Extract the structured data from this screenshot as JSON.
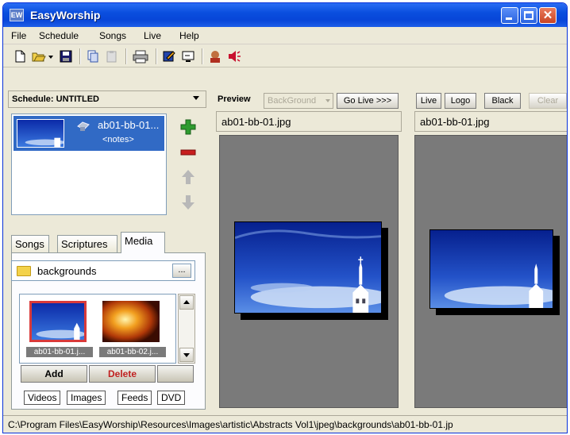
{
  "window": {
    "title": "EasyWorship",
    "icon_text": "EW"
  },
  "menu": {
    "items": [
      "File",
      "Schedule",
      "Songs",
      "Live",
      "Help"
    ]
  },
  "toolbar": {
    "icons": [
      "new-icon",
      "open-icon",
      "dropdown-arrow-icon",
      "save-icon",
      "copy-icon",
      "paste-icon",
      "print-icon",
      "edit-icon",
      "monitor-icon",
      "user-icon",
      "speaker-icon"
    ]
  },
  "schedule": {
    "label": "Schedule: UNTITLED",
    "items": [
      {
        "title": "ab01-bb-01...",
        "notes": "<notes>"
      }
    ],
    "side_buttons": [
      "add-icon",
      "remove-icon",
      "move-up-icon",
      "move-down-icon"
    ]
  },
  "tabs": {
    "items": [
      "Songs",
      "Scriptures",
      "Media"
    ],
    "active": "Media"
  },
  "media": {
    "folder": "backgrounds",
    "folder_button": "...",
    "images": [
      {
        "label": "ab01-bb-01.j...",
        "selected": true
      },
      {
        "label": "ab01-bb-02.j...",
        "selected": false
      }
    ],
    "add_label": "Add",
    "delete_label": "Delete",
    "bottom_tabs": [
      "Videos",
      "Images",
      "Feeds",
      "DVD"
    ],
    "bottom_tab_active": "Images"
  },
  "preview": {
    "label": "Preview",
    "background_select": "BackGround",
    "go_live": "Go Live >>>",
    "filename": "ab01-bb-01.jpg"
  },
  "live": {
    "buttons": [
      "Live",
      "Logo",
      "Black",
      "Clear"
    ],
    "disabled": [
      "Clear"
    ],
    "filename": "ab01-bb-01.jpg"
  },
  "status": {
    "path": "C:\\Program Files\\EasyWorship\\Resources\\Images\\artistic\\Abstracts Vol1\\jpeg\\backgrounds\\ab01-bb-01.jp"
  },
  "colors": {
    "titlebar": "#0846d8",
    "selection": "#316ac5",
    "delete_text": "#c02020",
    "add_icon": "#2e9b2e",
    "remove_icon": "#c81e1e"
  }
}
